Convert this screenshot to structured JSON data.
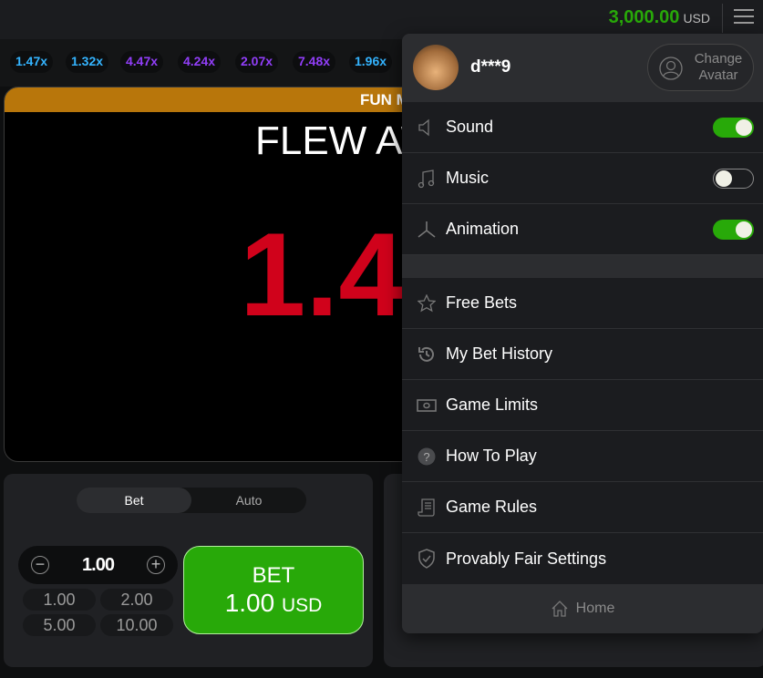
{
  "header": {
    "balance": "3,000.00",
    "currency": "USD"
  },
  "history": [
    {
      "value": "1.47x",
      "color": "#34b4ff"
    },
    {
      "value": "1.32x",
      "color": "#34b4ff"
    },
    {
      "value": "4.47x",
      "color": "#913ef8"
    },
    {
      "value": "4.24x",
      "color": "#913ef8"
    },
    {
      "value": "2.07x",
      "color": "#913ef8"
    },
    {
      "value": "7.48x",
      "color": "#913ef8"
    },
    {
      "value": "1.96x",
      "color": "#34b4ff"
    }
  ],
  "game": {
    "banner": "FUN MODE",
    "status": "FLEW AWAY!",
    "multiplier": "1.47x"
  },
  "bet_panel": {
    "tabs": [
      "Bet",
      "Auto"
    ],
    "active_tab": "Bet",
    "amount": "1.00",
    "quick": [
      "1.00",
      "2.00",
      "5.00",
      "10.00"
    ],
    "bet_label": "BET",
    "bet_amount": "1.00",
    "bet_currency": "USD"
  },
  "menu": {
    "username": "d***9",
    "change_avatar": [
      "Change",
      "Avatar"
    ],
    "toggles": [
      {
        "label": "Sound",
        "on": true,
        "icon": "speaker-icon"
      },
      {
        "label": "Music",
        "on": false,
        "icon": "music-icon"
      },
      {
        "label": "Animation",
        "on": true,
        "icon": "propeller-icon"
      }
    ],
    "items": [
      {
        "label": "Free Bets",
        "icon": "star-icon"
      },
      {
        "label": "My Bet History",
        "icon": "history-icon"
      },
      {
        "label": "Game Limits",
        "icon": "money-icon"
      },
      {
        "label": "How To Play",
        "icon": "question-icon"
      },
      {
        "label": "Game Rules",
        "icon": "scroll-icon"
      },
      {
        "label": "Provably Fair Settings",
        "icon": "shield-check-icon"
      }
    ],
    "home": "Home"
  },
  "colors": {
    "accent": "#28a909",
    "banner": "#b8760b",
    "multiplier": "#d0021b"
  }
}
